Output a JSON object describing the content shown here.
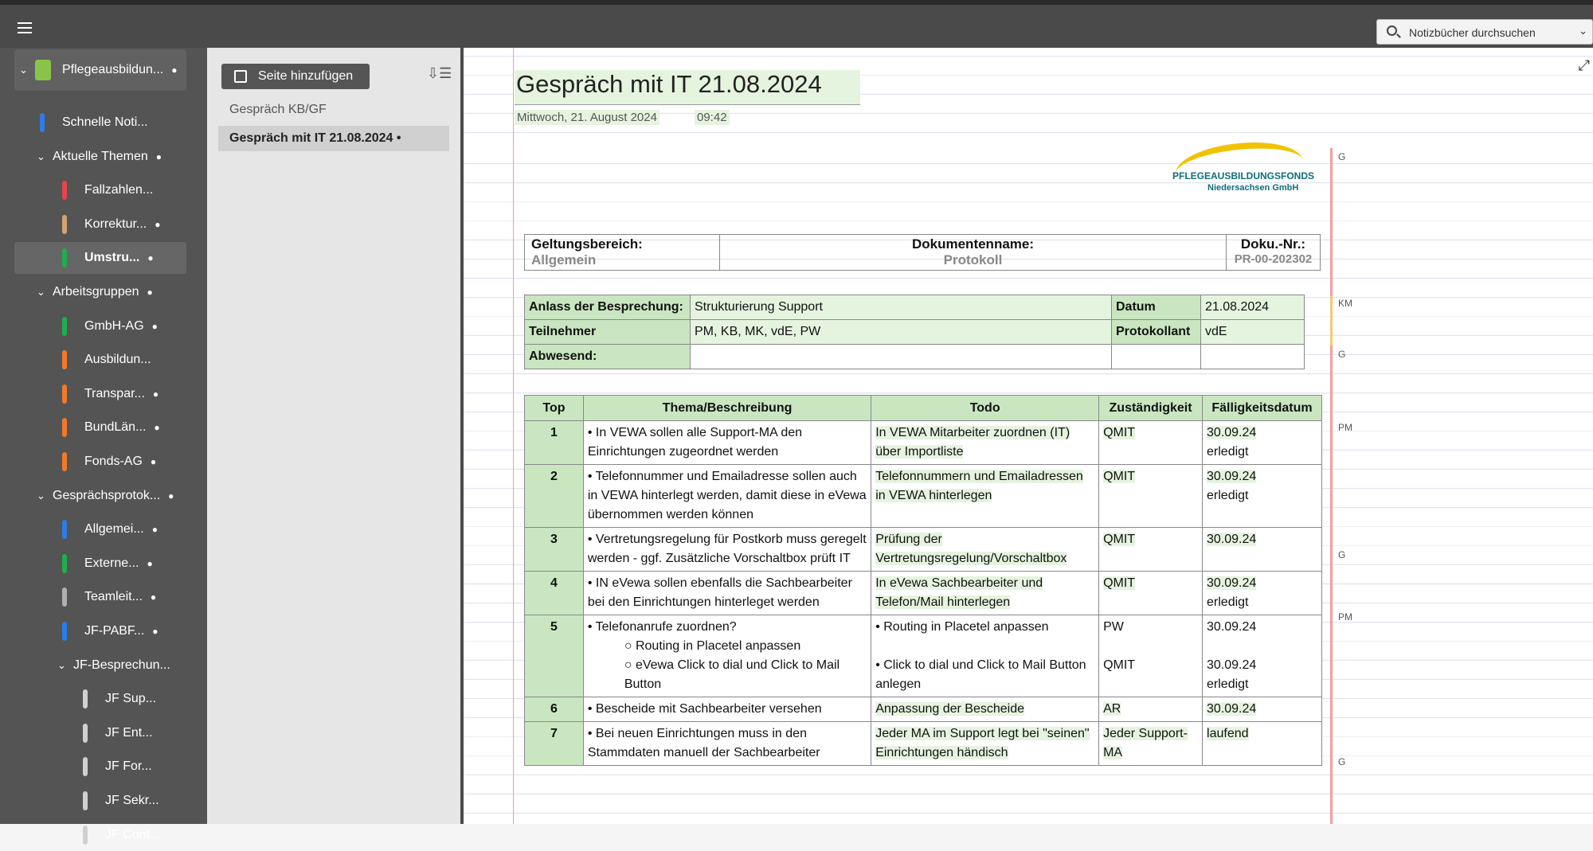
{
  "search": {
    "placeholder": "Notizbücher durchsuchen"
  },
  "notebook": {
    "name": "Pflegeausbildun...",
    "color": "#8bc34a"
  },
  "sidebar": {
    "items": [
      {
        "label": "Schnelle Noti...",
        "color": "#2b7de9",
        "dot": false
      },
      {
        "label": "Aktuelle Themen",
        "group": true,
        "dot": true
      },
      {
        "label": "Fallzahlen...",
        "color": "#e8434b",
        "dot": false
      },
      {
        "label": "Korrektur...",
        "color": "#d3a36f",
        "dot": true
      },
      {
        "label": "Umstru...",
        "color": "#1fae4c",
        "dot": true,
        "selected": true
      },
      {
        "label": "Arbeitsgruppen",
        "group": true,
        "dot": true
      },
      {
        "label": "GmbH-AG",
        "color": "#1fae4c",
        "dot": true
      },
      {
        "label": "Ausbildun...",
        "color": "#f07a2a",
        "dot": false
      },
      {
        "label": "Transpar...",
        "color": "#f07a2a",
        "dot": true
      },
      {
        "label": "BundLän...",
        "color": "#f07a2a",
        "dot": true
      },
      {
        "label": "Fonds-AG",
        "color": "#f07a2a",
        "dot": true
      },
      {
        "label": "Gesprächsprotok...",
        "group": true,
        "dot": true
      },
      {
        "label": "Allgemei...",
        "color": "#2b7de9",
        "dot": true
      },
      {
        "label": "Externe...",
        "color": "#1fae4c",
        "dot": true
      },
      {
        "label": "Teamleit...",
        "color": "#b0b0b0",
        "dot": true
      },
      {
        "label": "JF-PABF...",
        "color": "#2b7de9",
        "dot": true
      },
      {
        "label": "JF-Besprechun...",
        "group": true,
        "dot": false
      },
      {
        "label": "JF Sup...",
        "color": "#d0d0d0",
        "dot": false
      },
      {
        "label": "JF Ent...",
        "color": "#d0d0d0",
        "dot": false
      },
      {
        "label": "JF For...",
        "color": "#d0d0d0",
        "dot": false
      },
      {
        "label": "JF Sekr...",
        "color": "#d0d0d0",
        "dot": false
      },
      {
        "label": "JF Cont...",
        "color": "#d0d0d0",
        "dot": false
      }
    ]
  },
  "pages": {
    "add_label": "Seite hinzufügen",
    "list": [
      {
        "title": "Gespräch KB/GF"
      },
      {
        "title": "Gespräch mit IT 21.08.2024 •"
      }
    ]
  },
  "note": {
    "title": "Gespräch mit IT 21.08.2024",
    "date": "Mittwoch, 21. August 2024",
    "time": "09:42",
    "logo_line1": "PFLEGEAUSBILDUNGSFONDS",
    "logo_line2": "Niedersachsen GmbH",
    "margin_notes": [
      "G",
      "KM",
      "G",
      "PM",
      "G",
      "PM",
      "G"
    ],
    "header_table": {
      "c1_label": "Geltungsbereich:",
      "c1_value": "Allgemein",
      "c2_label": "Dokumentenname:",
      "c2_value": "Protokoll",
      "c3_label": "Doku.-Nr.:",
      "c3_value": "PR-00-202302"
    },
    "meta_table": {
      "anlass_label": "Anlass der Besprechung:",
      "anlass_value": "Strukturierung Support",
      "datum_label": "Datum",
      "datum_value": "21.08.2024",
      "teilnehmer_label": "Teilnehmer",
      "teilnehmer_value": "PM, KB, MK, vdE, PW",
      "protokollant_label": "Protokollant",
      "protokollant_value": "vdE",
      "abwesend_label": "Abwesend:"
    },
    "topics": {
      "headers": [
        "Top",
        "Thema/Beschreibung",
        "Todo",
        "Zuständigkeit",
        "Fälligkeitsdatum"
      ],
      "rows": [
        {
          "num": "1",
          "thema": "In VEWA sollen alle Support-MA den Einrichtungen zugeordnet werden",
          "todo": "In VEWA Mitarbeiter zuordnen (IT) über Importliste",
          "zust": "QMIT",
          "faellig": "30.09.24",
          "status": "erledigt"
        },
        {
          "num": "2",
          "thema": "Telefonnummer und Emailadresse sollen auch in VEWA hinterlegt werden, damit diese in eVewa übernommen werden können",
          "todo": "Telefonnummern und Emailadressen in VEWA hinterlegen",
          "zust": "QMIT",
          "faellig": "30.09.24",
          "status": "erledigt"
        },
        {
          "num": "3",
          "thema": "Vertretungsregelung für Postkorb muss geregelt werden - ggf. Zusätzliche Vorschaltbox prüft IT",
          "todo": "Prüfung der Vertretungsregelung/Vorschaltbox",
          "zust": "QMIT",
          "faellig": "30.09.24",
          "status": ""
        },
        {
          "num": "4",
          "thema": "IN eVewa sollen ebenfalls die Sachbearbeiter bei den Einrichtungen hinterleget werden",
          "todo": "In eVewa Sachbearbeiter und Telefon/Mail hinterlegen",
          "zust": "QMIT",
          "faellig": "30.09.24",
          "status": "erledigt"
        },
        {
          "num": "6",
          "thema": "Bescheide mit Sachbearbeiter versehen",
          "todo": "Anpassung der Bescheide",
          "zust": "AR",
          "faellig": "30.09.24",
          "status": ""
        },
        {
          "num": "7",
          "thema": "Bei neuen Einrichtungen muss in den Stammdaten manuell der Sachbearbeiter",
          "todo": "Jeder MA im Support legt bei \"seinen\" Einrichtungen händisch",
          "zust": "Jeder Support-MA",
          "faellig": "laufend",
          "status": ""
        }
      ],
      "row5": {
        "num": "5",
        "thema": "Telefonanrufe zuordnen?",
        "sub1": "Routing in Placetel anpassen",
        "sub2": "eVewa Click to dial und Click to Mail Button",
        "todo1": "Routing in Placetel anpassen",
        "todo2": "Click to dial und Click to Mail Button anlegen",
        "zust1": "PW",
        "zust2": "QMIT",
        "faellig1": "30.09.24",
        "faellig2": "30.09.24",
        "status2": "erledigt"
      }
    }
  }
}
